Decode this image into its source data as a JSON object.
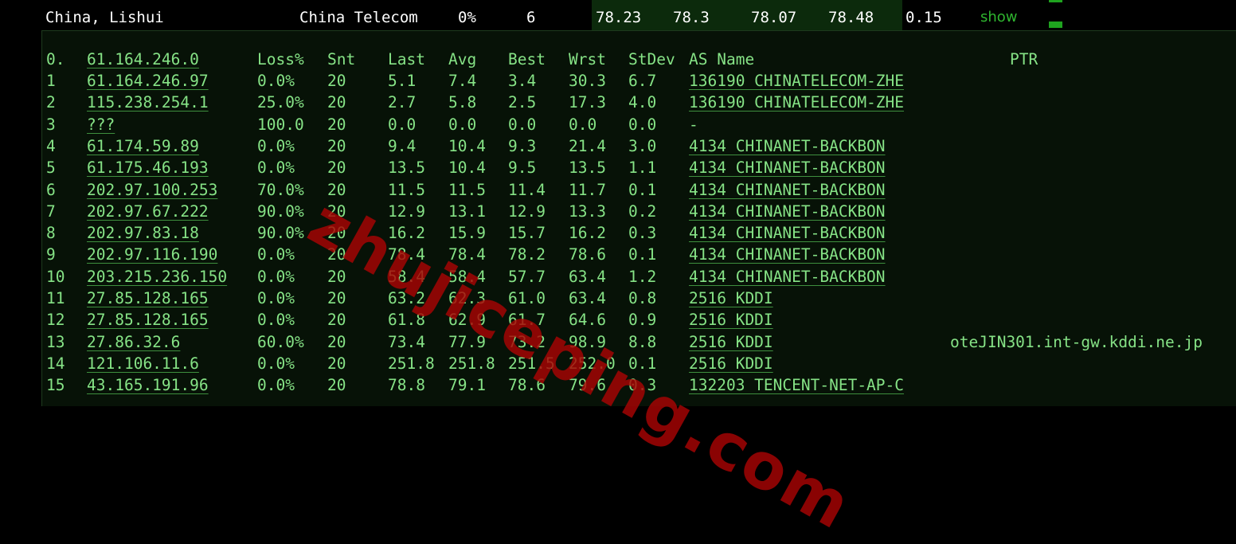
{
  "summary": {
    "location": "China, Lishui",
    "isp": "China Telecom",
    "loss": "0%",
    "sent": "6",
    "last": "78.23",
    "avg": "78.3",
    "best": "78.07",
    "worst": "78.48",
    "stdev": "0.15",
    "action": "show"
  },
  "trace": {
    "header": {
      "idx": "0.",
      "host": "61.164.246.0",
      "loss": "Loss%",
      "snt": "Snt",
      "last": "Last",
      "avg": "Avg",
      "best": "Best",
      "wrst": "Wrst",
      "stdev": "StDev",
      "as": "AS Name",
      "ptr": "PTR"
    },
    "hops": [
      {
        "idx": "1",
        "host": "61.164.246.97",
        "loss": "0.0%",
        "snt": "20",
        "last": "5.1",
        "avg": "7.4",
        "best": "3.4",
        "wrst": "30.3",
        "stdev": "6.7",
        "as": "136190 CHINATELECOM-ZHE",
        "ptr": ""
      },
      {
        "idx": "2",
        "host": "115.238.254.1",
        "loss": "25.0%",
        "snt": "20",
        "last": "2.7",
        "avg": "5.8",
        "best": "2.5",
        "wrst": "17.3",
        "stdev": "4.0",
        "as": "136190 CHINATELECOM-ZHE",
        "ptr": ""
      },
      {
        "idx": "3",
        "host": "???",
        "loss": "100.0",
        "snt": "20",
        "last": "0.0",
        "avg": "0.0",
        "best": "0.0",
        "wrst": "0.0",
        "stdev": "0.0",
        "as": "-",
        "ptr": ""
      },
      {
        "idx": "4",
        "host": "61.174.59.89",
        "loss": "0.0%",
        "snt": "20",
        "last": "9.4",
        "avg": "10.4",
        "best": "9.3",
        "wrst": "21.4",
        "stdev": "3.0",
        "as": "4134  CHINANET-BACKBON",
        "ptr": ""
      },
      {
        "idx": "5",
        "host": "61.175.46.193",
        "loss": "0.0%",
        "snt": "20",
        "last": "13.5",
        "avg": "10.4",
        "best": "9.5",
        "wrst": "13.5",
        "stdev": "1.1",
        "as": "4134  CHINANET-BACKBON",
        "ptr": ""
      },
      {
        "idx": "6",
        "host": "202.97.100.253",
        "loss": "70.0%",
        "snt": "20",
        "last": "11.5",
        "avg": "11.5",
        "best": "11.4",
        "wrst": "11.7",
        "stdev": "0.1",
        "as": "4134  CHINANET-BACKBON",
        "ptr": ""
      },
      {
        "idx": "7",
        "host": "202.97.67.222",
        "loss": "90.0%",
        "snt": "20",
        "last": "12.9",
        "avg": "13.1",
        "best": "12.9",
        "wrst": "13.3",
        "stdev": "0.2",
        "as": "4134  CHINANET-BACKBON",
        "ptr": ""
      },
      {
        "idx": "8",
        "host": "202.97.83.18",
        "loss": "90.0%",
        "snt": "20",
        "last": "16.2",
        "avg": "15.9",
        "best": "15.7",
        "wrst": "16.2",
        "stdev": "0.3",
        "as": "4134  CHINANET-BACKBON",
        "ptr": ""
      },
      {
        "idx": "9",
        "host": "202.97.116.190",
        "loss": "0.0%",
        "snt": "20",
        "last": "78.4",
        "avg": "78.4",
        "best": "78.2",
        "wrst": "78.6",
        "stdev": "0.1",
        "as": "4134  CHINANET-BACKBON",
        "ptr": ""
      },
      {
        "idx": "10",
        "host": "203.215.236.150",
        "loss": "0.0%",
        "snt": "20",
        "last": "58.4",
        "avg": "58.4",
        "best": "57.7",
        "wrst": "63.4",
        "stdev": "1.2",
        "as": "4134  CHINANET-BACKBON",
        "ptr": ""
      },
      {
        "idx": "11",
        "host": "27.85.128.165",
        "loss": "0.0%",
        "snt": "20",
        "last": "63.2",
        "avg": "62.3",
        "best": "61.0",
        "wrst": "63.4",
        "stdev": "0.8",
        "as": "2516  KDDI",
        "ptr": ""
      },
      {
        "idx": "12",
        "host": "27.85.128.165",
        "loss": "0.0%",
        "snt": "20",
        "last": "61.8",
        "avg": "62.9",
        "best": "61.7",
        "wrst": "64.6",
        "stdev": "0.9",
        "as": "2516  KDDI",
        "ptr": ""
      },
      {
        "idx": "13",
        "host": "27.86.32.6",
        "loss": "60.0%",
        "snt": "20",
        "last": "73.4",
        "avg": "77.9",
        "best": "73.2",
        "wrst": "98.9",
        "stdev": "8.8",
        "as": "2516  KDDI",
        "ptr": "oteJIN301.int-gw.kddi.ne.jp"
      },
      {
        "idx": "14",
        "host": "121.106.11.6",
        "loss": "0.0%",
        "snt": "20",
        "last": "251.8",
        "avg": "251.8",
        "best": "251.5",
        "wrst": "252.0",
        "stdev": "0.1",
        "as": "2516  KDDI",
        "ptr": ""
      },
      {
        "idx": "15",
        "host": "43.165.191.96",
        "loss": "0.0%",
        "snt": "20",
        "last": "78.8",
        "avg": "79.1",
        "best": "78.6",
        "wrst": "79.6",
        "stdev": "0.3",
        "as": "132203 TENCENT-NET-AP-C",
        "ptr": ""
      }
    ]
  },
  "watermark": "zhujiceping.com",
  "colors": {
    "background": "#000000",
    "text_white": "#ffffff",
    "text_green": "#86e386",
    "show_link": "#2fb52f",
    "panel_bg": "#071207",
    "watermark": "#a80404"
  }
}
